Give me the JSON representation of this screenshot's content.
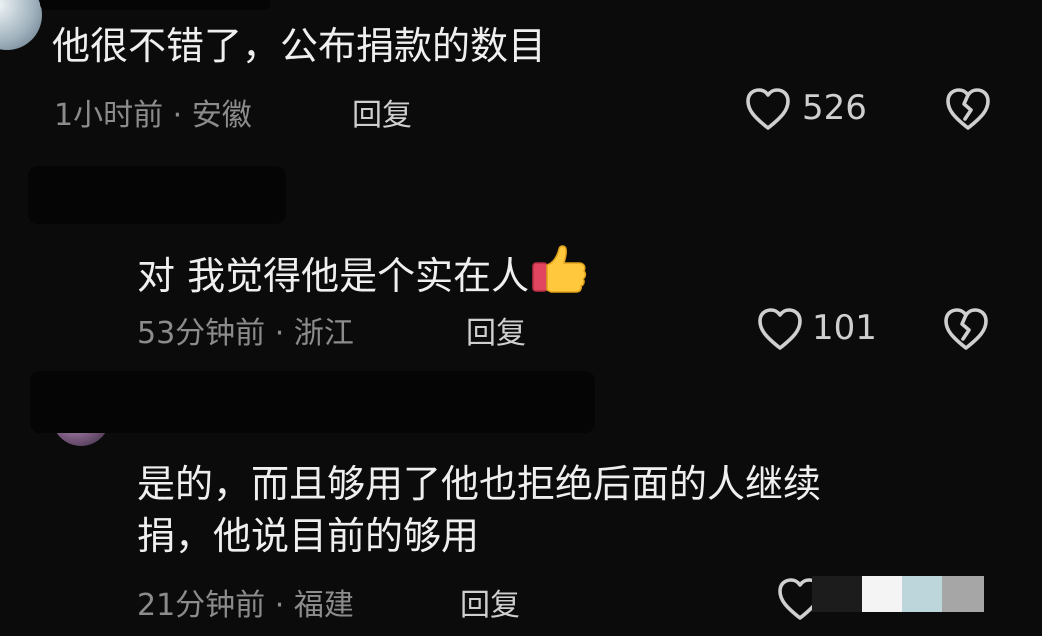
{
  "comments": [
    {
      "text": "他很不错了，公布捐款的数目",
      "time": "1小时前",
      "location": "安徽",
      "reply_label": "回复",
      "likes": "526"
    },
    {
      "text": "对 我觉得他是个实在人",
      "emoji": "thumbs-up",
      "time": "53分钟前",
      "location": "浙江",
      "reply_label": "回复",
      "likes": "101"
    },
    {
      "text_line1": "是的，而且够用了他也拒绝后面的人继续",
      "text_line2": "捐，他说目前的够用",
      "time": "21分钟前",
      "location": "福建",
      "reply_label": "回复"
    }
  ],
  "separator": "·",
  "colors": {
    "background": "#0b0b0b",
    "text": "#efefef",
    "meta": "#8c8c8c",
    "icon": "#cfcfcf"
  }
}
